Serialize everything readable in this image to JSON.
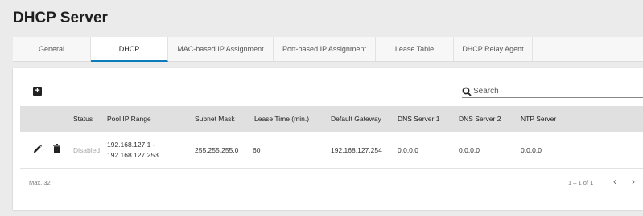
{
  "page": {
    "title": "DHCP Server"
  },
  "tabs": [
    {
      "label": "General"
    },
    {
      "label": "DHCP"
    },
    {
      "label": "MAC-based IP Assignment"
    },
    {
      "label": "Port-based IP Assignment"
    },
    {
      "label": "Lease Table"
    },
    {
      "label": "DHCP Relay Agent"
    }
  ],
  "active_tab": "DHCP",
  "toolbar": {
    "add_icon": "plus-box-icon",
    "search_placeholder": "Search",
    "search_value": ""
  },
  "table": {
    "headers": [
      "Status",
      "Pool IP Range",
      "Subnet Mask",
      "Lease Time (min.)",
      "Default Gateway",
      "DNS Server 1",
      "DNS Server 2",
      "NTP Server"
    ],
    "rows": [
      {
        "status": "Disabled",
        "pool_ip_range_line1": "192.168.127.1 -",
        "pool_ip_range_line2": "192.168.127.253",
        "subnet_mask": "255.255.255.0",
        "lease_time": "60",
        "default_gateway": "192.168.127.254",
        "dns_server_1": "0.0.0.0",
        "dns_server_2": "0.0.0.0",
        "ntp_server": "0.0.0.0"
      }
    ]
  },
  "footer": {
    "max_label": "Max. 32",
    "range_label": "1 – 1 of 1"
  },
  "colors": {
    "accent": "#0b7cbc",
    "header_bg": "#e0e0e0",
    "disabled_text": "#aaaaaa"
  }
}
